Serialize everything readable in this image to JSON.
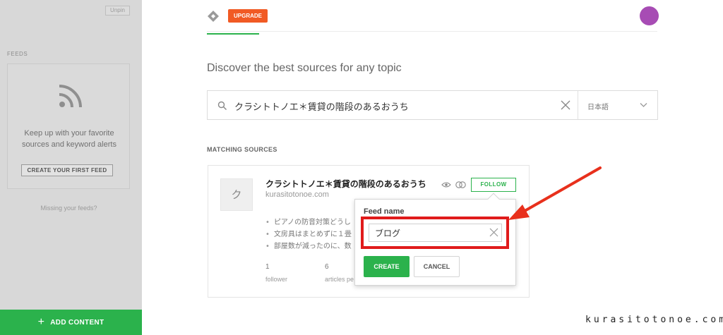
{
  "sidebar": {
    "unpin_label": "Unpin",
    "feeds_label": "FEEDS",
    "card_text": "Keep up with your favorite sources and keyword alerts",
    "create_feed_label": "CREATE YOUR FIRST FEED",
    "missing_feeds": "Missing your feeds?",
    "add_content_label": "ADD CONTENT"
  },
  "header": {
    "upgrade_label": "UPGRADE",
    "avatar_color": "#a74cb4"
  },
  "main": {
    "heading": "Discover the best sources for any topic",
    "search": {
      "value": "クラシトトノエ＊賃貸の階段のあるおうち",
      "language": "日本語"
    },
    "matching_label": "MATCHING SOURCES",
    "source": {
      "thumb_letter": "ク",
      "title": "クラシトトノエ＊賃貸の階段のあるおうち",
      "url": "kurasitotonoe.com",
      "follow_label": "FOLLOW",
      "articles": [
        "ピアノの防音対策どうし",
        "文房具はまとめずに１畳",
        "部屋数が減ったのに、数"
      ],
      "followers_value": "1",
      "followers_label": "follower",
      "articles_value": "6",
      "articles_label": "articles pe"
    }
  },
  "popup": {
    "label": "Feed name",
    "input_value": "ブログ",
    "create_label": "CREATE",
    "cancel_label": "CANCEL"
  },
  "annotation": {
    "highlight_color": "#e01b1b",
    "arrow_color": "#e8301c"
  },
  "watermark": "kurasitotonoe.com",
  "colors": {
    "accent_green": "#2bb24c",
    "upgrade_orange": "#f15a24"
  }
}
